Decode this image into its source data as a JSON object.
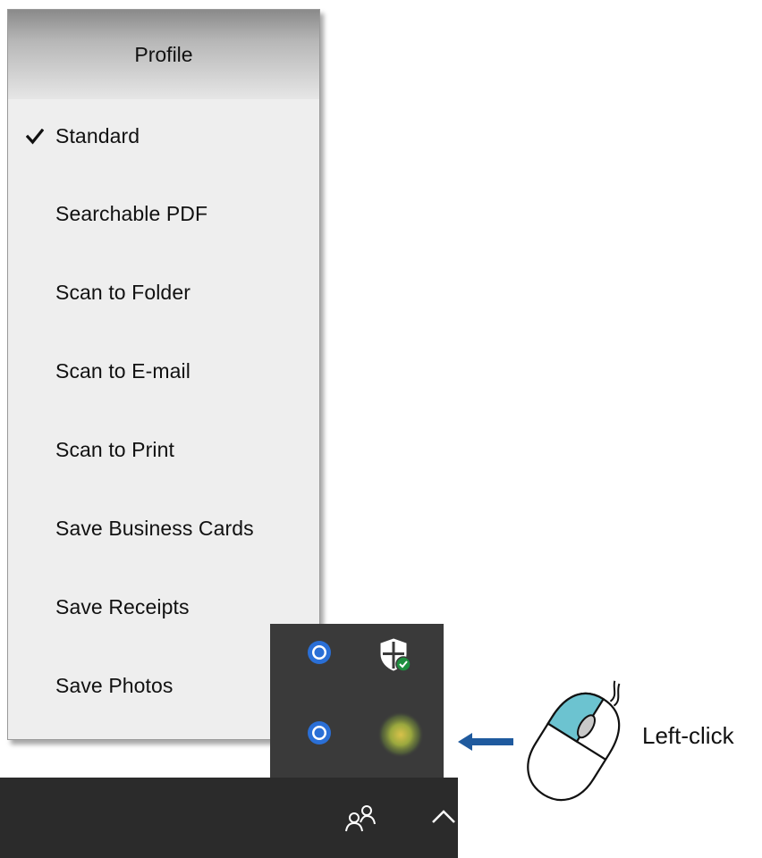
{
  "menu": {
    "header": "Profile",
    "items": [
      {
        "label": "Standard",
        "checked": true
      },
      {
        "label": "Searchable PDF",
        "checked": false
      },
      {
        "label": "Scan to Folder",
        "checked": false
      },
      {
        "label": "Scan to E-mail",
        "checked": false
      },
      {
        "label": "Scan to Print",
        "checked": false
      },
      {
        "label": "Save Business Cards",
        "checked": false
      },
      {
        "label": "Save Receipts",
        "checked": false
      },
      {
        "label": "Save Photos",
        "checked": false
      }
    ]
  },
  "tray": {
    "icons": [
      "blue-round-icon",
      "security-shield-icon",
      "blue-round-icon",
      "app-icon"
    ]
  },
  "taskbar": {
    "icons": [
      "people-icon",
      "chevron-up-icon"
    ]
  },
  "instruction": {
    "label": "Left-click",
    "arrow_color": "#1f5a9e",
    "mouse_button_color": "#6cc3d0"
  }
}
